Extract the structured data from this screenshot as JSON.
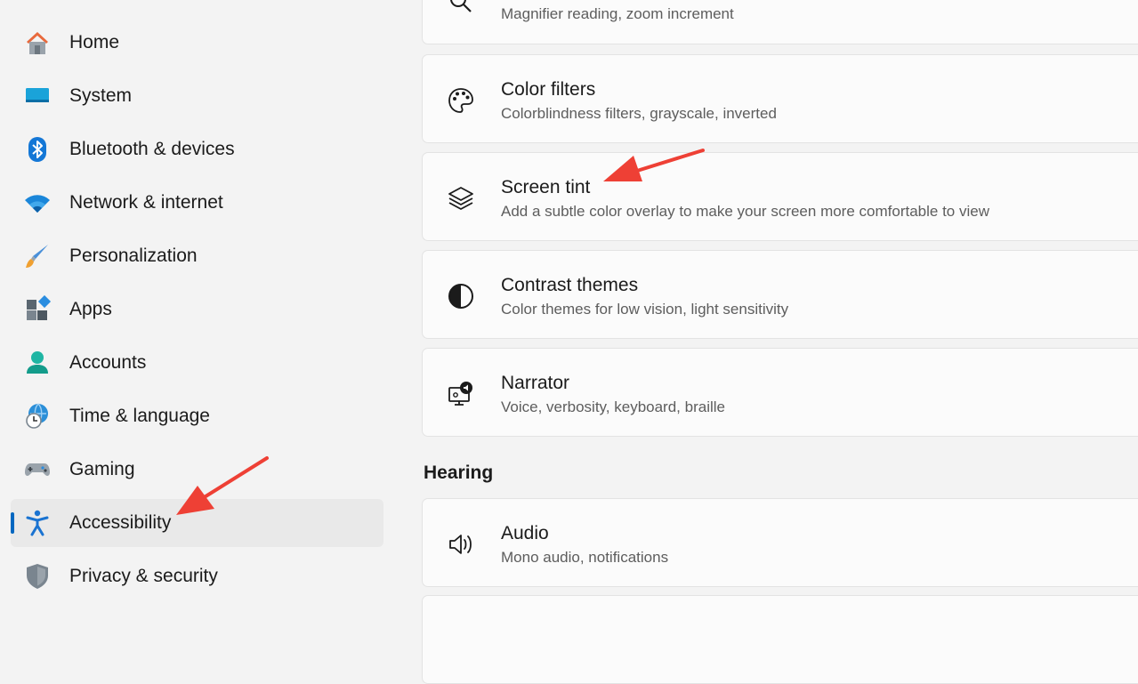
{
  "sidebar": {
    "items": [
      {
        "label": "Home",
        "icon": "home-icon"
      },
      {
        "label": "System",
        "icon": "monitor-icon"
      },
      {
        "label": "Bluetooth & devices",
        "icon": "bluetooth-icon"
      },
      {
        "label": "Network & internet",
        "icon": "wifi-icon"
      },
      {
        "label": "Personalization",
        "icon": "brush-icon"
      },
      {
        "label": "Apps",
        "icon": "apps-icon"
      },
      {
        "label": "Accounts",
        "icon": "person-icon"
      },
      {
        "label": "Time & language",
        "icon": "clock-globe-icon"
      },
      {
        "label": "Gaming",
        "icon": "gamepad-icon"
      },
      {
        "label": "Accessibility",
        "icon": "accessibility-icon",
        "selected": true
      },
      {
        "label": "Privacy & security",
        "icon": "shield-icon"
      }
    ]
  },
  "main": {
    "cards": [
      {
        "title": "",
        "subtitle": "Magnifier reading, zoom increment",
        "icon": "magnifier-icon"
      },
      {
        "title": "Color filters",
        "subtitle": "Colorblindness filters, grayscale, inverted",
        "icon": "palette-icon"
      },
      {
        "title": "Screen tint",
        "subtitle": "Add a subtle color overlay to make your screen more comfortable to view",
        "icon": "layers-icon"
      },
      {
        "title": "Contrast themes",
        "subtitle": "Color themes for low vision, light sensitivity",
        "icon": "contrast-icon"
      },
      {
        "title": "Narrator",
        "subtitle": "Voice, verbosity, keyboard, braille",
        "icon": "narrator-icon"
      }
    ],
    "hearing_heading": "Hearing",
    "hearing_cards": [
      {
        "title": "Audio",
        "subtitle": "Mono audio, notifications",
        "icon": "speaker-icon"
      }
    ]
  },
  "colors": {
    "accent": "#0067c0",
    "annotation_arrow": "#ee4035"
  }
}
